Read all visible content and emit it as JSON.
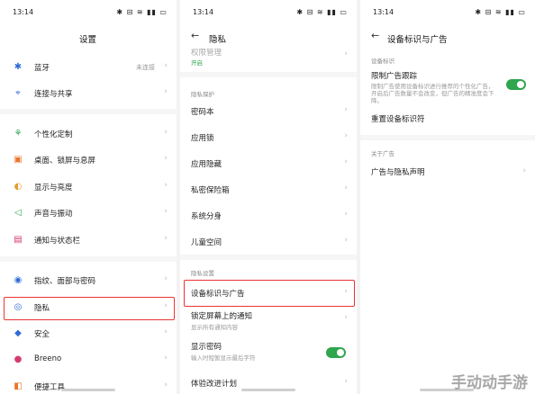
{
  "status": {
    "time": "13:14",
    "icons_text": "✱ ⊟ ≋ ▮▮ ▭"
  },
  "panel1": {
    "title": "设置",
    "items": [
      {
        "icon": "bluetooth-icon",
        "glyph": "✱",
        "color": "#2f6bd7",
        "label": "蓝牙",
        "value": "未连接"
      },
      {
        "icon": "share-icon",
        "glyph": "⌖",
        "color": "#2f6bd7",
        "label": "连接与共享",
        "value": ""
      },
      {
        "icon": "personalize-icon",
        "glyph": "⚘",
        "color": "#2fa54e",
        "label": "个性化定制",
        "value": ""
      },
      {
        "icon": "wallpaper-icon",
        "glyph": "▣",
        "color": "#e8752a",
        "label": "桌面、锁屏与息屏",
        "value": ""
      },
      {
        "icon": "display-icon",
        "glyph": "◐",
        "color": "#e89a2a",
        "label": "显示与亮度",
        "value": ""
      },
      {
        "icon": "sound-icon",
        "glyph": "◁",
        "color": "#2fa54e",
        "label": "声音与振动",
        "value": ""
      },
      {
        "icon": "notification-icon",
        "glyph": "▤",
        "color": "#d73b6b",
        "label": "通知与状态栏",
        "value": ""
      },
      {
        "icon": "fingerprint-icon",
        "glyph": "◉",
        "color": "#2f6bd7",
        "label": "指纹、面部与密码",
        "value": ""
      },
      {
        "icon": "privacy-icon",
        "glyph": "◎",
        "color": "#2f6bd7",
        "label": "隐私",
        "value": ""
      },
      {
        "icon": "security-icon",
        "glyph": "◆",
        "color": "#2f6bd7",
        "label": "安全",
        "value": ""
      },
      {
        "icon": "breeno-icon",
        "glyph": "●",
        "color": "#d73b6b",
        "label": "Breeno",
        "value": ""
      },
      {
        "icon": "tools-icon",
        "glyph": "◧",
        "color": "#e8752a",
        "label": "便捷工具",
        "value": ""
      }
    ]
  },
  "panel2": {
    "title": "隐私",
    "top_item": {
      "label": "权限管理",
      "sub": "开启"
    },
    "section1": "隐私保护",
    "items1": [
      "密码本",
      "应用锁",
      "应用隐藏",
      "私密保险箱",
      "系统分身",
      "儿童空间"
    ],
    "section2": "隐私设置",
    "items2": [
      {
        "label": "设备标识与广告",
        "sub": ""
      },
      {
        "label": "锁定屏幕上的通知",
        "sub": "显示所有通知内容"
      },
      {
        "label": "显示密码",
        "sub": "输入时短暂显示最后字符"
      },
      {
        "label": "体验改进计划",
        "sub": ""
      }
    ]
  },
  "panel3": {
    "title": "设备标识与广告",
    "section1": "设备标识",
    "limit_label": "限制广告跟踪",
    "limit_desc": "限制广告使用设备标识进行推荐的个性化广告，开启后广告数量不会改变，但广告的精准度会下降。",
    "reset_label": "重置设备标识符",
    "section2": "关于广告",
    "about_label": "广告与隐私声明"
  },
  "colors": {
    "accent_green": "#2fa54e",
    "highlight_red": "#e33333",
    "icon_blue": "#2f6bd7"
  },
  "watermark": "手动动手游"
}
